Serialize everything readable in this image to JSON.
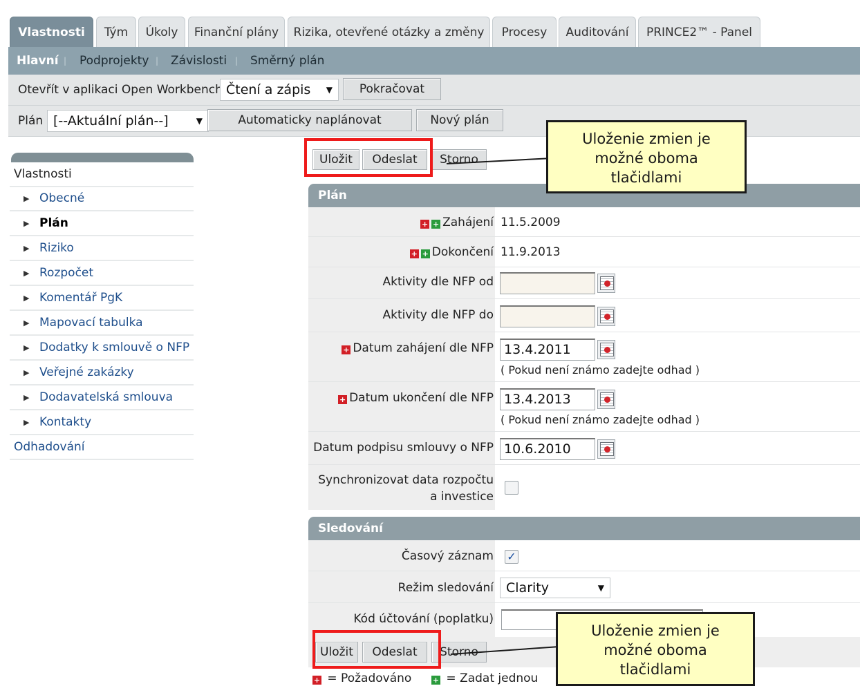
{
  "tabs": [
    {
      "label": "Vlastnosti",
      "active": true
    },
    {
      "label": "Tým"
    },
    {
      "label": "Úkoly"
    },
    {
      "label": "Finanční plány"
    },
    {
      "label": "Rizika, otevřené otázky a změny"
    },
    {
      "label": "Procesy"
    },
    {
      "label": "Auditování"
    },
    {
      "label": "PRINCE2™ - Panel"
    }
  ],
  "subnav": [
    "Hlavní",
    "Podprojekty",
    "Závislosti",
    "Směrný plán"
  ],
  "toolbar1": {
    "label": "Otevřít v aplikaci Open Workbench",
    "mode": "Čtení a zápis",
    "continue": "Pokračovat"
  },
  "toolbar2": {
    "label": "Plán",
    "plan": "[--Aktuální plán--]",
    "auto": "Automaticky naplánovat",
    "new_plan": "Nový plán"
  },
  "left_menu": {
    "header": "Vlastnosti",
    "items": [
      "Obecné",
      "Plán",
      "Riziko",
      "Rozpočet",
      "Komentář PgK",
      "Mapovací tabulka",
      "Dodatky k smlouvě o NFP",
      "Veřejné zakázky",
      "Dodavatelská smlouva",
      "Kontakty"
    ],
    "selected": "Plán",
    "footer": "Odhadování"
  },
  "buttons": {
    "save": "Uložit",
    "send": "Odeslat",
    "cancel": "Storno"
  },
  "plan_section": {
    "title": "Plán",
    "start_label": "Zahájení",
    "start_value": "11.5.2009",
    "end_label": "Dokončení",
    "end_value": "11.9.2013",
    "act_from_label": "Aktivity dle NFP od",
    "act_to_label": "Aktivity dle NFP do",
    "nfp_start_label": "Datum zahájení dle NFP",
    "nfp_start_value": "13.4.2011",
    "nfp_end_label": "Datum ukončení dle NFP",
    "nfp_end_value": "13.4.2013",
    "hint": "( Pokud není známo zadejte odhad )",
    "sign_label": "Datum podpisu smlouvy o NFP",
    "sign_value": "10.6.2010",
    "sync_label_1": "Synchronizovat data rozpočtu",
    "sync_label_2": "a investice"
  },
  "tracking_section": {
    "title": "Sledování",
    "time_label": "Časový záznam",
    "mode_label": "Režim sledování",
    "mode_value": "Clarity",
    "charge_label": "Kód účtování (poplatku)"
  },
  "callout_text": {
    "line1": "Uloženie zmien je",
    "line2": "možné oboma",
    "line3": "tlačidlami"
  },
  "legend": {
    "required": "= Požadováno",
    "one": "= Zadat jednou"
  }
}
